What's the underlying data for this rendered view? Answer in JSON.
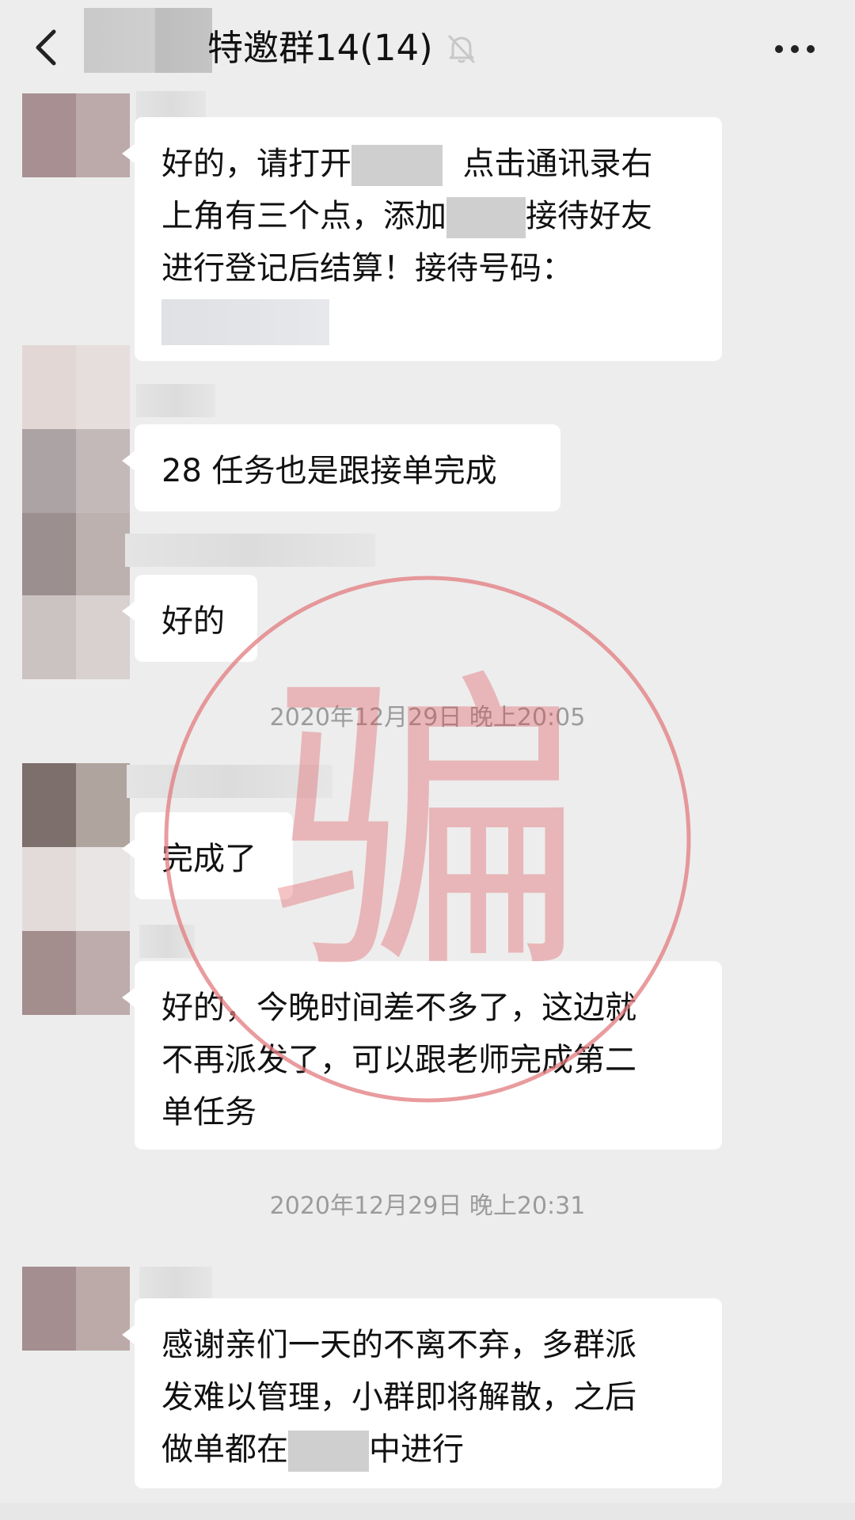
{
  "header": {
    "title": "特邀群14(14)",
    "back_icon": "chevron-left-icon",
    "mute_icon": "bell-off-icon",
    "more_icon": "more-dots-icon"
  },
  "messages": [
    {
      "lines": [
        "好的，请打开",
        "点击通讯录右",
        "上角有三个点，添加",
        "接待好友",
        "进行登记后结算！接待号码："
      ]
    },
    {
      "text": "28 任务也是跟接单完成"
    },
    {
      "text": "好的"
    },
    {
      "text": "完成了"
    },
    {
      "lines": [
        "好的，今晚时间差不多了，这边就",
        "不再派发了，可以跟老师完成第二",
        "单任务"
      ]
    },
    {
      "lines": [
        "感谢亲们一天的不离不弃，多群派",
        "发难以管理，小群即将解散，之后",
        "做单都在",
        "中进行"
      ]
    }
  ],
  "timestamps": [
    "2020年12月29日 晚上20:05",
    "2020年12月29日 晚上20:31"
  ],
  "stamp": {
    "text": "骗",
    "color": "#e0464a"
  }
}
